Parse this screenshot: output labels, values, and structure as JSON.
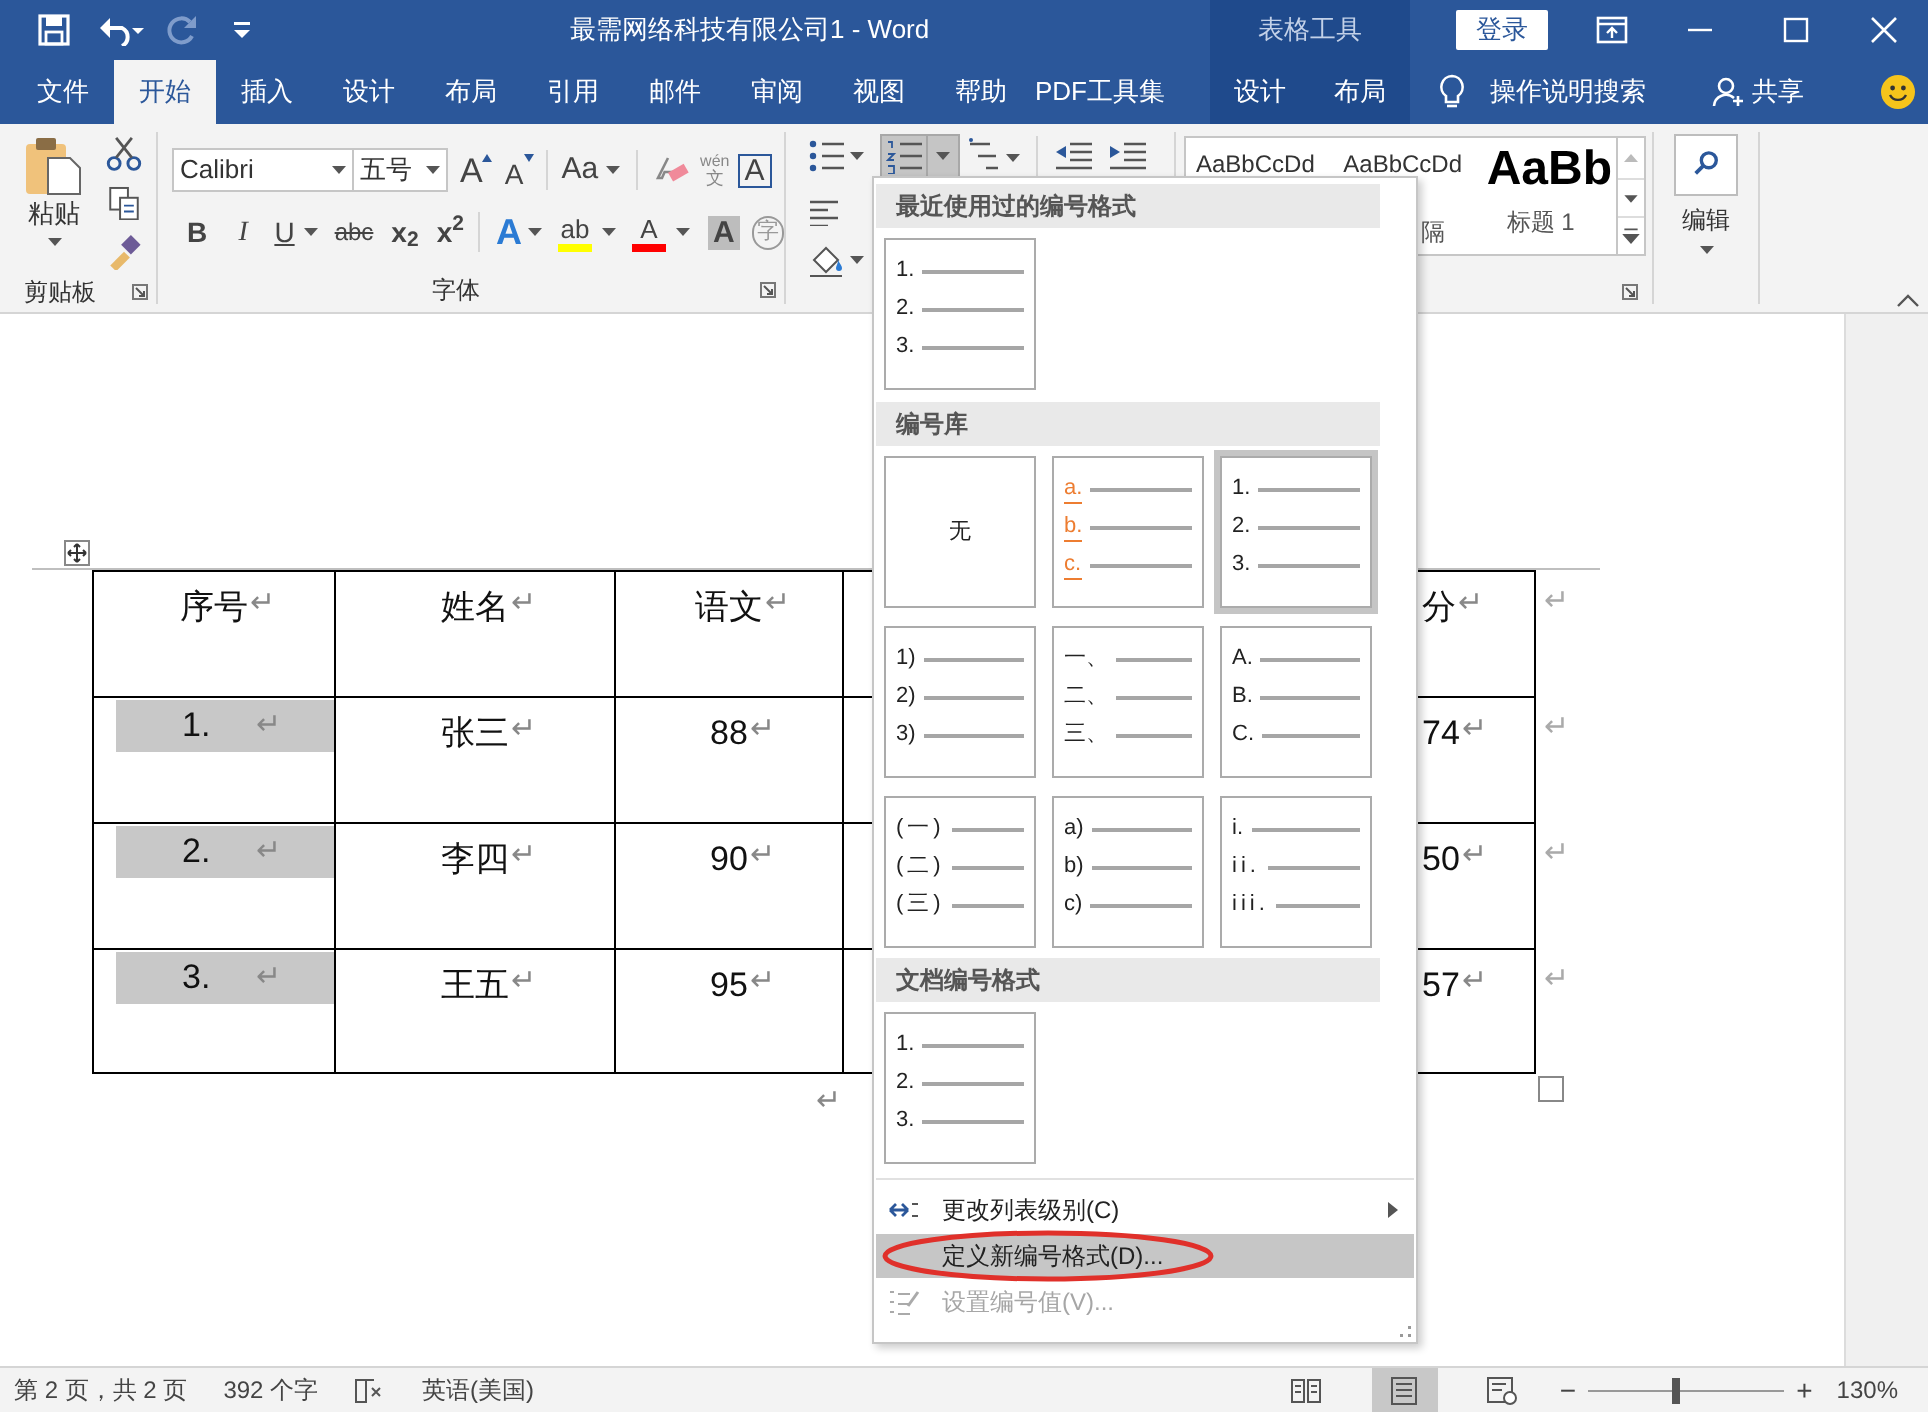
{
  "window": {
    "title": "最需网络科技有限公司1  -  Word",
    "context_group": "表格工具",
    "sign_in": "登录"
  },
  "ribbon_tabs": [
    {
      "label": "文件",
      "selected": false
    },
    {
      "label": "开始",
      "selected": true
    },
    {
      "label": "插入",
      "selected": false
    },
    {
      "label": "设计",
      "selected": false
    },
    {
      "label": "布局",
      "selected": false
    },
    {
      "label": "引用",
      "selected": false
    },
    {
      "label": "邮件",
      "selected": false
    },
    {
      "label": "审阅",
      "selected": false
    },
    {
      "label": "视图",
      "selected": false
    },
    {
      "label": "帮助",
      "selected": false
    },
    {
      "label": "PDF工具集",
      "selected": false
    }
  ],
  "context_tabs": [
    {
      "label": "设计",
      "selected": false
    },
    {
      "label": "布局",
      "selected": false
    }
  ],
  "tell_me": "操作说明搜索",
  "share": "共享",
  "clipboard": {
    "paste": "粘贴",
    "group_label": "剪贴板"
  },
  "font": {
    "name": "Calibri",
    "size": "五号",
    "group_label": "字体",
    "row1": [
      {
        "kind": "grow",
        "glyph": "A"
      },
      {
        "kind": "shrink",
        "glyph": "A"
      },
      {
        "kind": "case",
        "glyph": "Aa"
      },
      {
        "kind": "clear"
      },
      {
        "kind": "phonetic",
        "glyph": "wén",
        "glyph2": "文"
      },
      {
        "kind": "border",
        "glyph": "A"
      }
    ],
    "row2": [
      {
        "kind": "bold",
        "glyph": "B"
      },
      {
        "kind": "italic",
        "glyph": "I"
      },
      {
        "kind": "underline",
        "glyph": "U"
      },
      {
        "kind": "strike",
        "glyph": "abc"
      },
      {
        "kind": "sub",
        "glyph": "x$_{2}$"
      },
      {
        "kind": "sup",
        "glyph": "x$^{2}$"
      },
      {
        "kind": "effects",
        "glyph": "A"
      },
      {
        "kind": "highlight",
        "glyph": "ab",
        "color": "#ffff00"
      },
      {
        "kind": "fontcolor",
        "glyph": "A",
        "color": "#ff0000"
      },
      {
        "kind": "shading",
        "glyph": "A"
      },
      {
        "kind": "enclose",
        "glyph": "字"
      }
    ]
  },
  "paragraph": {
    "numbering_pressed": true
  },
  "styles": {
    "samples": [
      {
        "sample": "AaBbCcDd"
      },
      {
        "sample": "AaBbCcDd",
        "label": "隔"
      },
      {
        "sample": "AaBb",
        "label": "标题 1"
      }
    ]
  },
  "editing": {
    "label": "编辑"
  },
  "table": {
    "header": [
      {
        "text": "序号",
        "mark": "↵"
      },
      {
        "text": "姓名",
        "mark": "↵"
      },
      {
        "text": "语文",
        "mark": "↵"
      },
      {
        "text": "分",
        "mark": "↵"
      }
    ],
    "rows": [
      {
        "number": "1.",
        "mark": "↵",
        "cells": [
          {
            "text": "张三",
            "mark": "↵"
          },
          {
            "text": "88",
            "mark": "↵"
          },
          {
            "text": "74",
            "mark": "↵"
          }
        ]
      },
      {
        "number": "2.",
        "mark": "↵",
        "cells": [
          {
            "text": "李四",
            "mark": "↵"
          },
          {
            "text": "90",
            "mark": "↵"
          },
          {
            "text": "50",
            "mark": "↵"
          }
        ]
      },
      {
        "number": "3.",
        "mark": "↵",
        "cells": [
          {
            "text": "王五",
            "mark": "↵"
          },
          {
            "text": "95",
            "mark": "↵"
          },
          {
            "text": "57",
            "mark": "↵"
          }
        ]
      }
    ],
    "row_end_mark": "↵",
    "after_mark": "↵"
  },
  "numbering_menu": {
    "sections": [
      {
        "title": "最近使用过的编号格式",
        "formats": [
          {
            "kind": "list",
            "markers": [
              "1.",
              "2.",
              "3."
            ],
            "selected": false
          }
        ]
      },
      {
        "title": "编号库",
        "formats": [
          {
            "kind": "none",
            "label": "无",
            "selected": false
          },
          {
            "kind": "list",
            "markers": [
              "a.",
              "b.",
              "c."
            ],
            "color": "#ed7d31",
            "selected": false
          },
          {
            "kind": "list",
            "markers": [
              "1.",
              "2.",
              "3."
            ],
            "selected": true
          },
          {
            "kind": "list",
            "markers": [
              "1)",
              "2)",
              "3)"
            ],
            "selected": false
          },
          {
            "kind": "list",
            "markers": [
              "一、",
              "二、",
              "三、"
            ],
            "selected": false
          },
          {
            "kind": "list",
            "markers": [
              "A.",
              "B.",
              "C."
            ],
            "selected": false
          },
          {
            "kind": "list",
            "markers": [
              "(一)",
              "(二)",
              "(三)"
            ],
            "selected": false
          },
          {
            "kind": "list",
            "markers": [
              "a)",
              "b)",
              "c)"
            ],
            "selected": false
          },
          {
            "kind": "list",
            "markers": [
              "i.",
              "ii.",
              "iii."
            ],
            "selected": false
          }
        ]
      },
      {
        "title": "文档编号格式",
        "formats": [
          {
            "kind": "list",
            "markers": [
              "1.",
              "2.",
              "3."
            ],
            "selected": false
          }
        ]
      }
    ],
    "items": [
      {
        "kind": "submenu",
        "label": "更改列表级别(C)",
        "highlighted": false,
        "disabled": false,
        "circled": false
      },
      {
        "kind": "define",
        "label": "定义新编号格式(D)...",
        "highlighted": true,
        "disabled": false,
        "circled": true
      },
      {
        "kind": "setvalue",
        "label": "设置编号值(V)...",
        "highlighted": false,
        "disabled": true,
        "circled": false
      }
    ]
  },
  "status_bar": {
    "page": "第 2 页，共 2 页",
    "words": "392 个字",
    "language": "英语(美国)",
    "views": [
      {
        "kind": "read",
        "selected": false
      },
      {
        "kind": "print",
        "selected": true
      },
      {
        "kind": "web",
        "selected": false
      }
    ],
    "zoom_out": "−",
    "zoom_in": "+",
    "zoom": {
      "level": 0.45
    },
    "zoom_percent": "130%"
  }
}
